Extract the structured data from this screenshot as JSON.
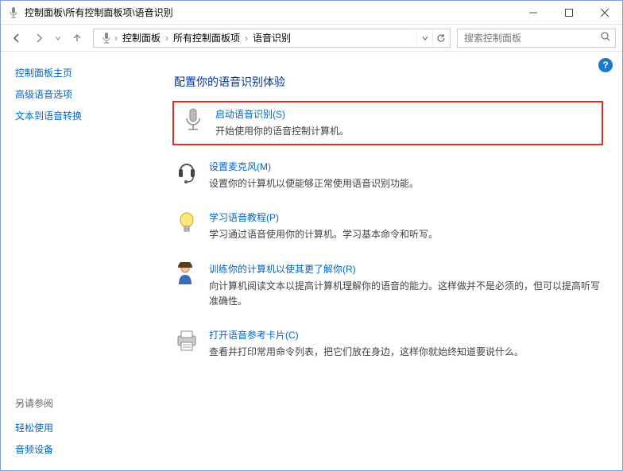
{
  "window": {
    "title": "控制面板\\所有控制面板项\\语音识别"
  },
  "breadcrumb": {
    "items": [
      "控制面板",
      "所有控制面板项",
      "语音识别"
    ]
  },
  "search": {
    "placeholder": "搜索控制面板"
  },
  "sidebar": {
    "home": "控制面板主页",
    "links": [
      "高级语音选项",
      "文本到语音转换"
    ],
    "footer_title": "另请参阅",
    "footer_links": [
      "轻松使用",
      "音频设备"
    ]
  },
  "main": {
    "title": "配置你的语音识别体验",
    "options": [
      {
        "icon": "microphone-icon",
        "link": "启动语音识别(S)",
        "desc": "开始使用你的语音控制计算机。",
        "highlighted": true
      },
      {
        "icon": "headset-icon",
        "link": "设置麦克风(M)",
        "desc": "设置你的计算机以便能够正常使用语音识别功能。"
      },
      {
        "icon": "lightbulb-icon",
        "link": "学习语音教程(P)",
        "desc": "学习通过语音使用你的计算机。学习基本命令和听写。"
      },
      {
        "icon": "person-icon",
        "link": "训练你的计算机以使其更了解你(R)",
        "desc": "向计算机阅读文本以提高计算机理解你的语音的能力。这样做并不是必须的，但可以提高听写准确性。"
      },
      {
        "icon": "printer-icon",
        "link": "打开语音参考卡片(C)",
        "desc": "查看并打印常用命令列表，把它们放在身边，这样你就始终知道要说什么。"
      }
    ]
  }
}
